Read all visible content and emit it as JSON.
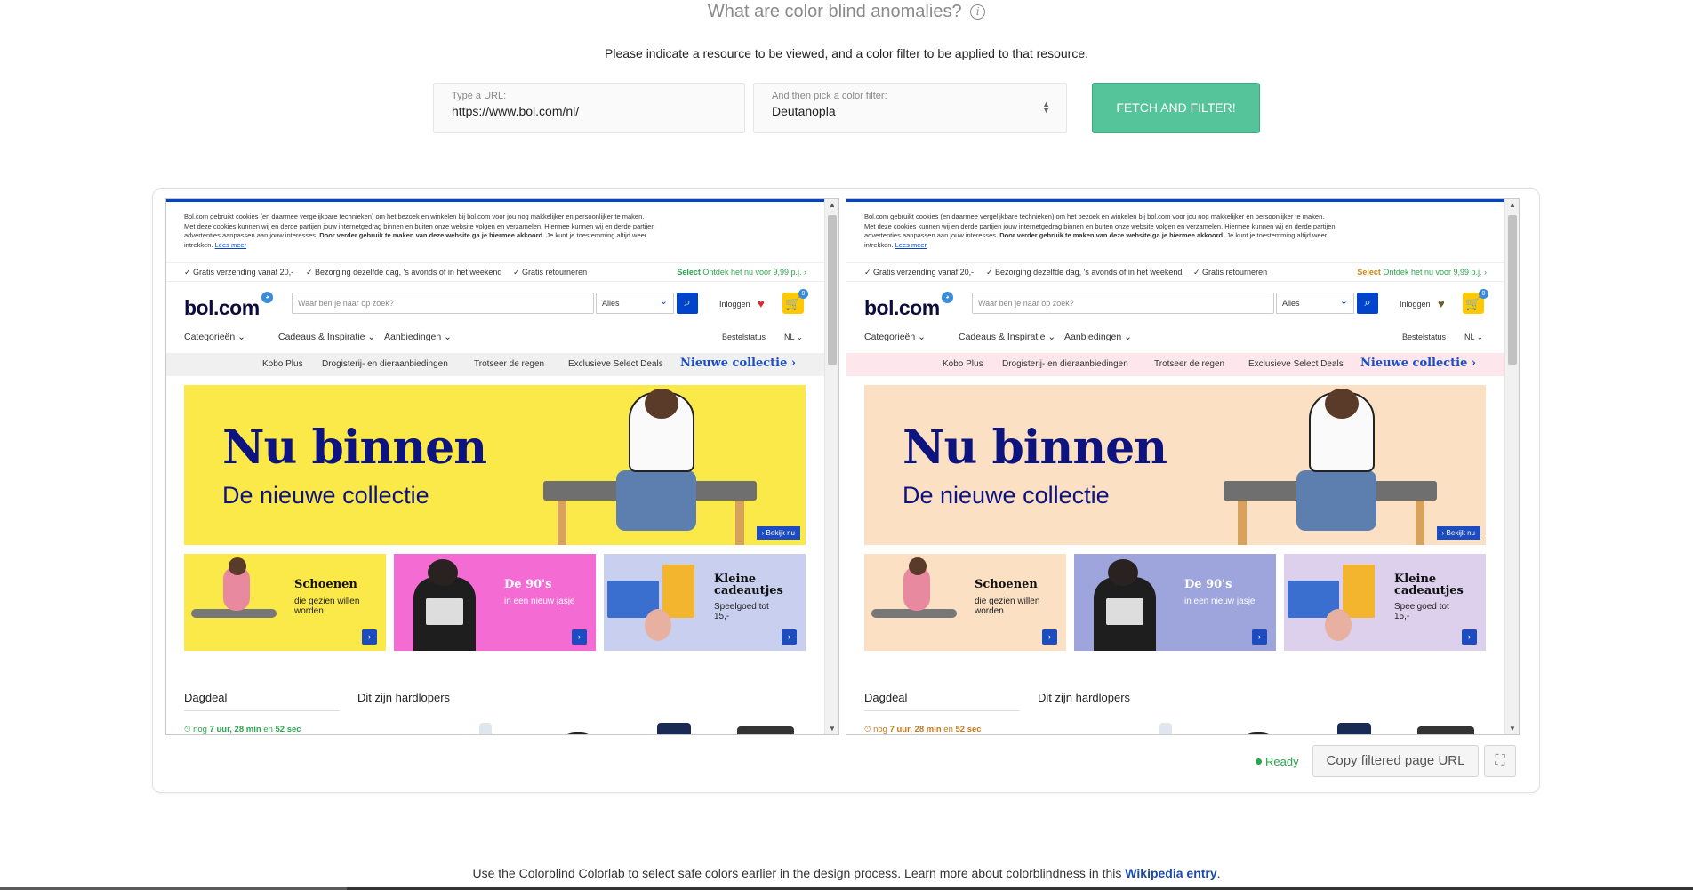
{
  "header": {
    "title": "What are color blind anomalies?",
    "info_glyph": "i",
    "instructions": "Please indicate a resource to be viewed, and a color filter to be applied to that resource."
  },
  "form": {
    "url_label": "Type a URL:",
    "url_value": "https://www.bol.com/nl/",
    "filter_label": "And then pick a color filter:",
    "filter_value": "Deutanopla",
    "fetch_button": "FETCH AND FILTER!"
  },
  "preview": {
    "cookie_text": "Bol.com gebruikt cookies (en daarmee vergelijkbare technieken) om het bezoek en winkelen bij bol.com voor jou nog makkelijker en persoonlijker te maken. Met deze cookies kunnen wij en derde partijen jouw internetgedrag binnen en buiten onze website volgen en verzamelen. Hiermee kunnen wij en derde partijen advertenties aanpassen aan jouw interesses.",
    "cookie_bold": "Door verder gebruik te maken van deze website ga je hiermee akkoord.",
    "cookie_tail": "Je kunt je toestemming altijd weer intrekken.",
    "cookie_link": "Lees meer",
    "usp_1": "✓ Gratis verzending vanaf 20,-",
    "usp_2": "✓ Bezorging dezelfde dag, 's avonds of in het weekend",
    "usp_3": "✓ Gratis retourneren",
    "usp_select": "Select",
    "usp_select_text": "Ontdek het nu voor 9,99 p.j. ›",
    "logo": "bol.com",
    "search_placeholder": "Waar ben je naar op zoek?",
    "search_category": "Alles",
    "login": "Inloggen",
    "nav_1": "Categorieën ⌄",
    "nav_2": "Cadeaus & Inspiratie ⌄",
    "nav_3": "Aanbiedingen ⌄",
    "nav_status": "Bestelstatus",
    "nav_lang": "NL ⌄",
    "strip_1": "Kobo Plus",
    "strip_2": "Drogisterij- en dieraanbiedingen",
    "strip_3": "Trotseer de regen",
    "strip_4": "Exclusieve Select Deals",
    "strip_5": "Nieuwe collectie ›",
    "hero_title": "Nu binnen",
    "hero_subtitle": "De nieuwe collectie",
    "hero_cta": "› Bekijk nu",
    "tile_1_title": "Schoenen",
    "tile_1_text": "die gezien willen worden",
    "tile_2_title": "De 90's",
    "tile_2_text": "in een nieuw jasje",
    "tile_3_title": "Kleine cadeautjes",
    "tile_3_text": "Speelgoed tot 15,-",
    "dagdeal": "Dagdeal",
    "hardlopers": "Dit zijn hardlopers",
    "timer_prefix": "nog",
    "timer_value": "7 uur, 28 min",
    "timer_mid": "en",
    "timer_secs": "52 sec"
  },
  "colors": {
    "original": {
      "hero_bg": "#fbe94a",
      "tile1_bg": "#fbe94a",
      "tile2_bg": "#f46bd4",
      "tile3_bg": "#c9d0ef",
      "strip_bg": "#f0f0f0",
      "heart": "#e0262b",
      "select": "#2aa54b",
      "timer": "#2aa54b"
    },
    "filtered": {
      "hero_bg": "#fbe0c4",
      "tile1_bg": "#fbe0c4",
      "tile2_bg": "#9ea4dc",
      "tile3_bg": "#dcd0ec",
      "strip_bg": "#fde7ec",
      "heart": "#6e5a2c",
      "select": "#c88a12",
      "timer": "#c8781a"
    }
  },
  "status": "Ready",
  "copy_button": "Copy filtered page URL",
  "expand_icon": "expand-icon",
  "footer": {
    "text": "Use the Colorblind Colorlab to select safe colors earlier in the design process. Learn more about colorblindness in this ",
    "link": "Wikipedia entry",
    "end": "."
  }
}
